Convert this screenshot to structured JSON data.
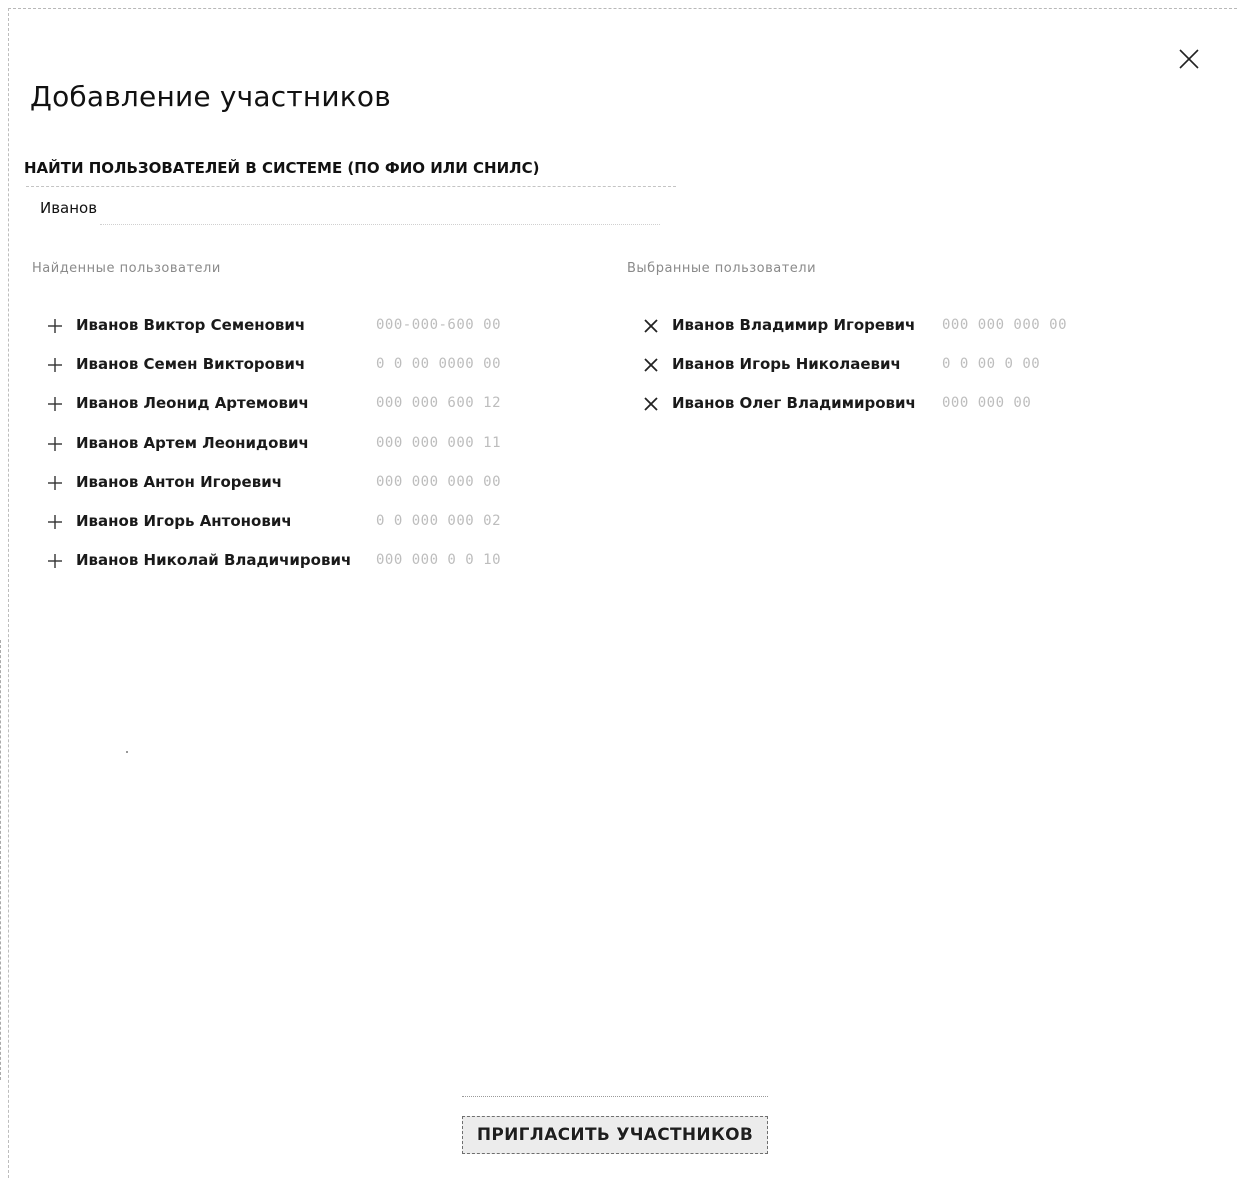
{
  "dialog": {
    "title": "Добавление участников",
    "close_icon": "close-icon"
  },
  "search": {
    "label": "НАЙТИ ПОЛЬЗОВАТЕЛЕЙ В СИСТЕМЕ (ПО ФИО ИЛИ СНИЛС)",
    "value": "Иванов"
  },
  "found": {
    "heading": "Найденные пользователи",
    "icon": "plus-icon",
    "items": [
      {
        "name": "Иванов Виктор Семенович",
        "snils": "000-000-600 00"
      },
      {
        "name": "Иванов Семен Викторович",
        "snils": "0 0 00 0000 00"
      },
      {
        "name": "Иванов Леонид Артемович",
        "snils": "000 000 600 12"
      },
      {
        "name": "Иванов Артем Леонидович",
        "snils": "000 000 000 11"
      },
      {
        "name": "Иванов Антон Игоревич",
        "snils": "000 000 000 00"
      },
      {
        "name": "Иванов Игорь Антонович",
        "snils": "0 0 000 000 02"
      },
      {
        "name": "Иванов Николай Владичирович",
        "snils": "000 000 0 0 10"
      }
    ]
  },
  "selected": {
    "heading": "Выбранные пользователи",
    "icon": "remove-icon",
    "items": [
      {
        "name": "Иванов Владимир Игоревич",
        "snils": "000 000 000 00"
      },
      {
        "name": "Иванов Игорь Николаевич",
        "snils": "0 0 00 0 00"
      },
      {
        "name": "Иванов Олег Владимирович",
        "snils": "000 000 00"
      }
    ]
  },
  "actions": {
    "invite_label": "ПРИГЛАСИТЬ УЧАСТНИКОВ"
  }
}
